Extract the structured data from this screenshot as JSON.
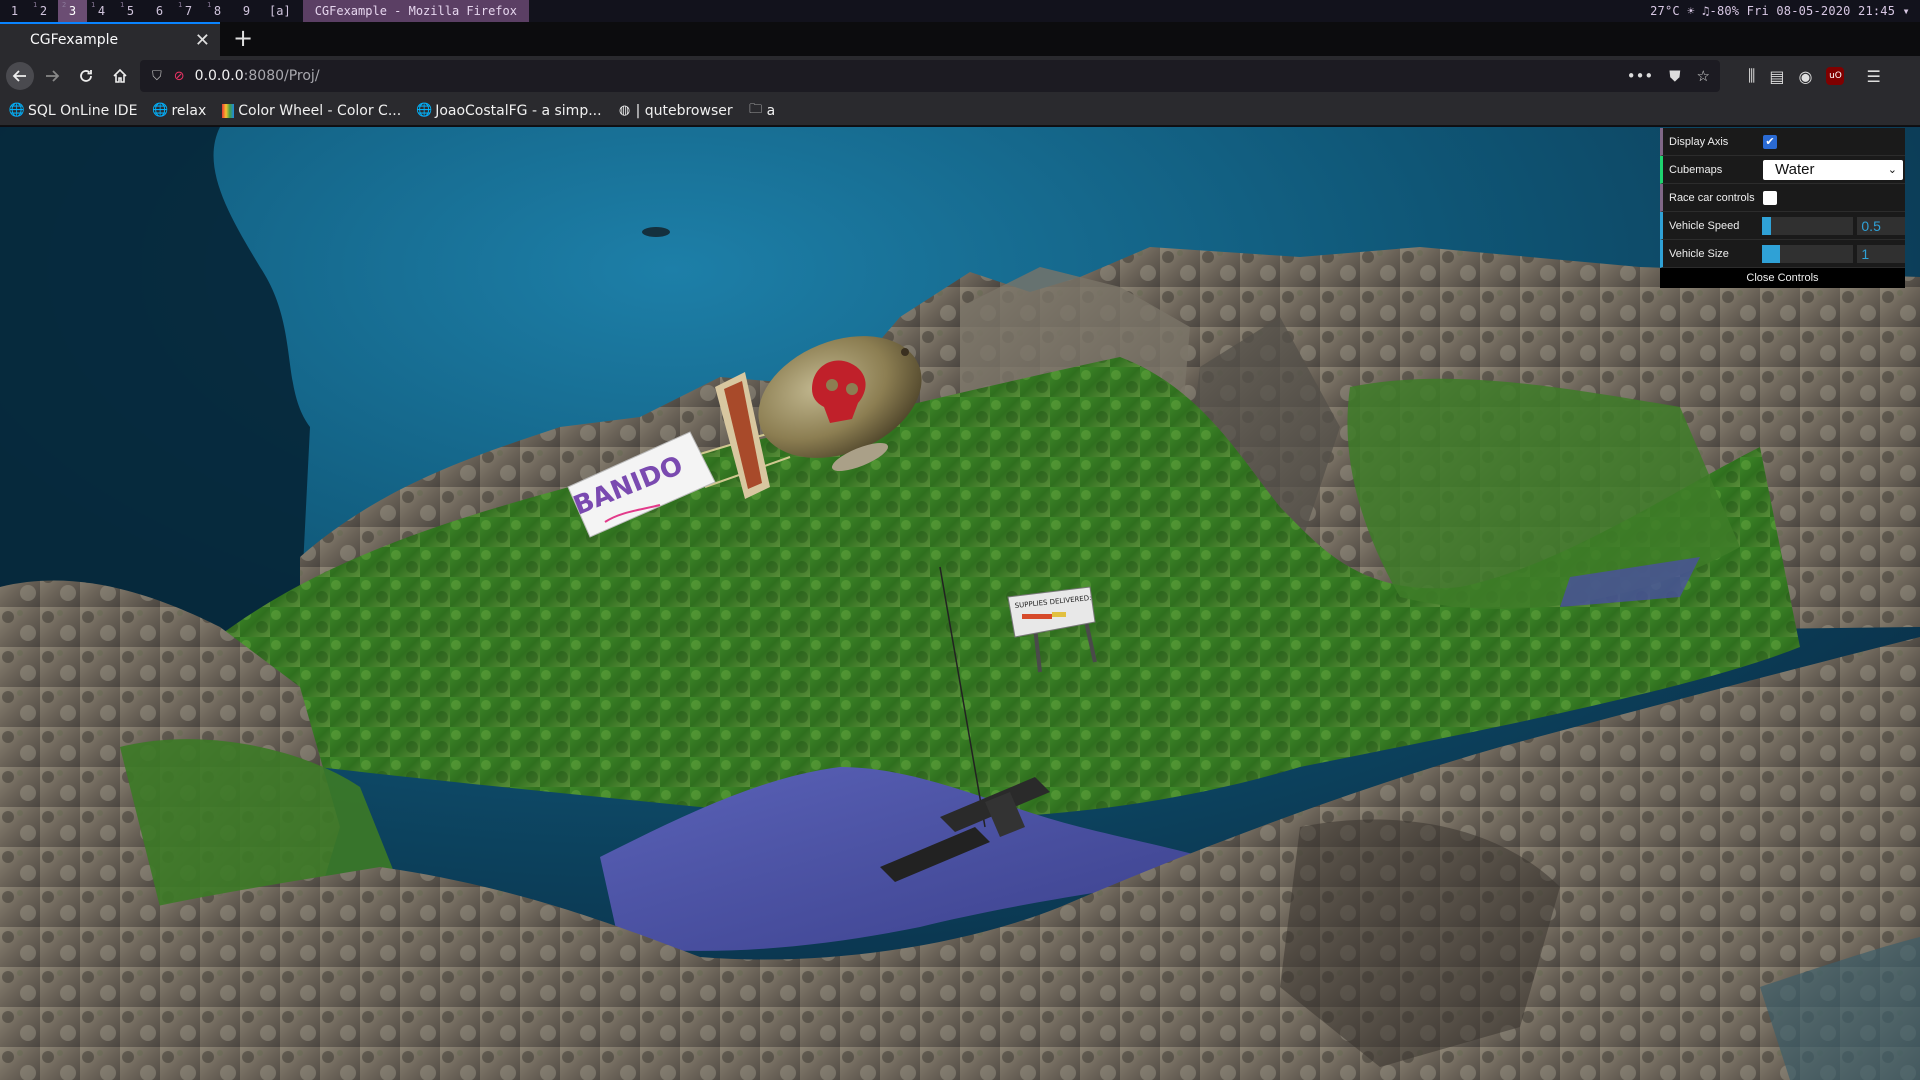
{
  "wm": {
    "workspaces": [
      {
        "num": "1",
        "sup": ""
      },
      {
        "num": "2",
        "sup": "1"
      },
      {
        "num": "3",
        "sup": "2"
      },
      {
        "num": "4",
        "sup": "1"
      },
      {
        "num": "5",
        "sup": "1"
      },
      {
        "num": "6",
        "sup": ""
      },
      {
        "num": "7",
        "sup": "1"
      },
      {
        "num": "8",
        "sup": "1"
      },
      {
        "num": "9",
        "sup": ""
      }
    ],
    "extra_workspace": "[a]",
    "window_title": "CGFexample - Mozilla Firefox",
    "status": "27°C ☀ ♫-80% Fri 08-05-2020 21:45 ▾"
  },
  "browser": {
    "tab_title": "CGFexample",
    "tab_close": "✕",
    "new_tab": "+",
    "url_host": "0.0.0.0",
    "url_path": ":8080/Proj/",
    "bookmarks": [
      {
        "label": "SQL OnLine IDE",
        "icon": "globe-icon"
      },
      {
        "label": "relax",
        "icon": "globe-icon"
      },
      {
        "label": "Color Wheel - Color C...",
        "icon": "color-wheel-icon"
      },
      {
        "label": "JoaoCostalFG - a simp...",
        "icon": "globe-icon"
      },
      {
        "label": "| qutebrowser",
        "icon": "qutebrowser-icon"
      },
      {
        "label": "a",
        "icon": "folder-icon"
      }
    ]
  },
  "scene": {
    "banner_text": "BANIDO",
    "sign_text": "SUPPLIES DELIVERED:"
  },
  "gui": {
    "display_axis_label": "Display Axis",
    "display_axis": true,
    "cubemaps_label": "Cubemaps",
    "cubemaps_value": "Water",
    "race_car_label": "Race car controls",
    "race_car": false,
    "speed_label": "Vehicle Speed",
    "speed_value": "0.5",
    "speed_fill": 0.1,
    "size_label": "Vehicle Size",
    "size_value": "1",
    "size_fill": 0.2,
    "close_label": "Close Controls"
  },
  "colors": {
    "accent": "#0a84ff",
    "gui_number": "#2fa1d6",
    "gui_select": "#1ed36f",
    "gui_bool": "#806787"
  }
}
